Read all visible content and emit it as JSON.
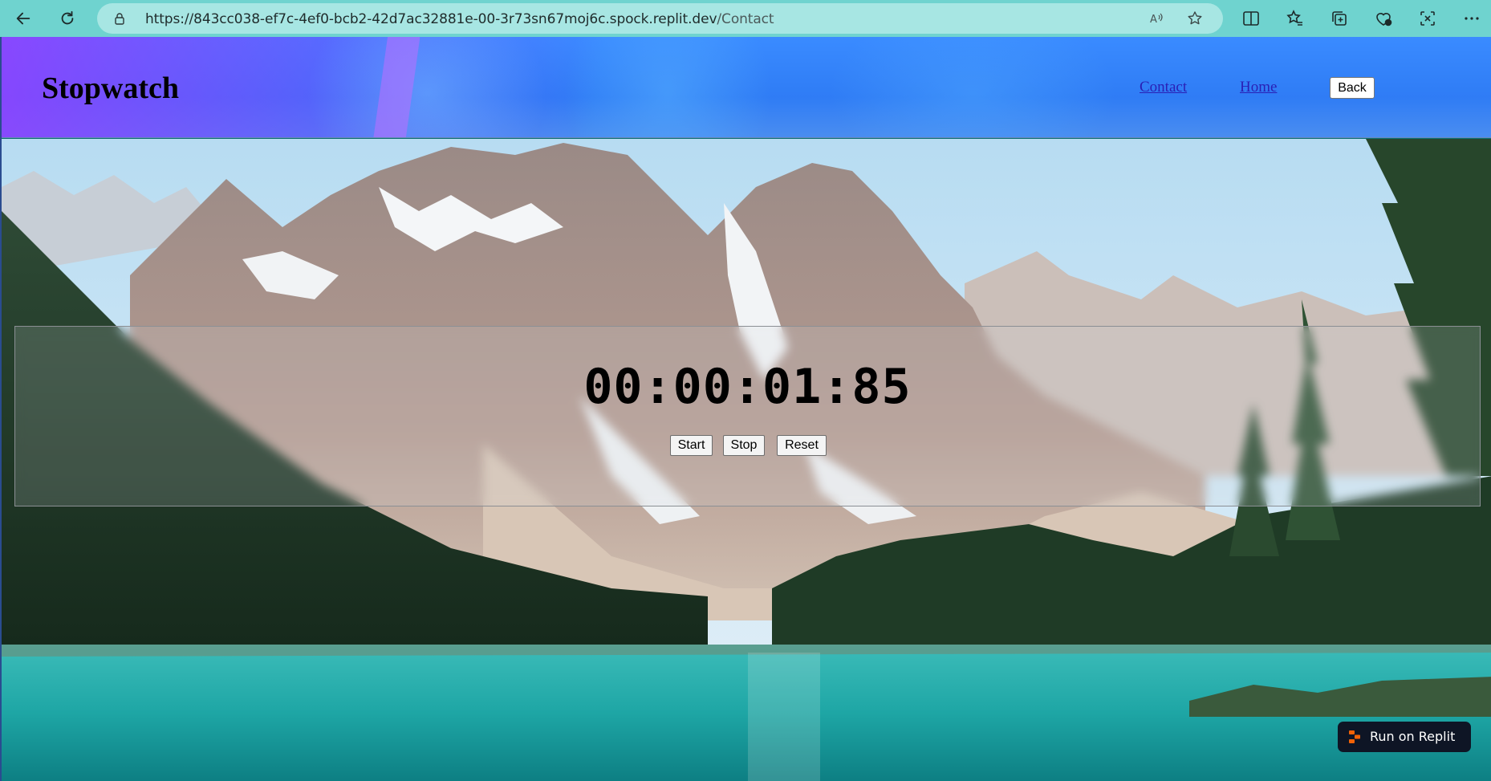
{
  "browser": {
    "url_base": "https://843cc038-ef7c-4ef0-bcb2-42d7ac32881e-00-3r73sn67moj6c.spock.replit.dev",
    "url_path": "/Contact"
  },
  "header": {
    "title": "Stopwatch",
    "nav": [
      {
        "label": "Contact"
      },
      {
        "label": "Home"
      }
    ],
    "back_label": "Back"
  },
  "stopwatch": {
    "time": "00:00:01:85",
    "buttons": {
      "start": "Start",
      "stop": "Stop",
      "reset": "Reset"
    }
  },
  "badge": {
    "label": "Run on Replit"
  },
  "colors": {
    "chrome": "#6fd3cf",
    "address_bar": "#a7e6e3",
    "header_blue": "#2f7cf5",
    "header_purple": "#9640ff",
    "link": "#2a1fb5",
    "lake": "#1aa3a3",
    "badge_bg": "#0e1525",
    "replit_orange": "#f26207"
  }
}
